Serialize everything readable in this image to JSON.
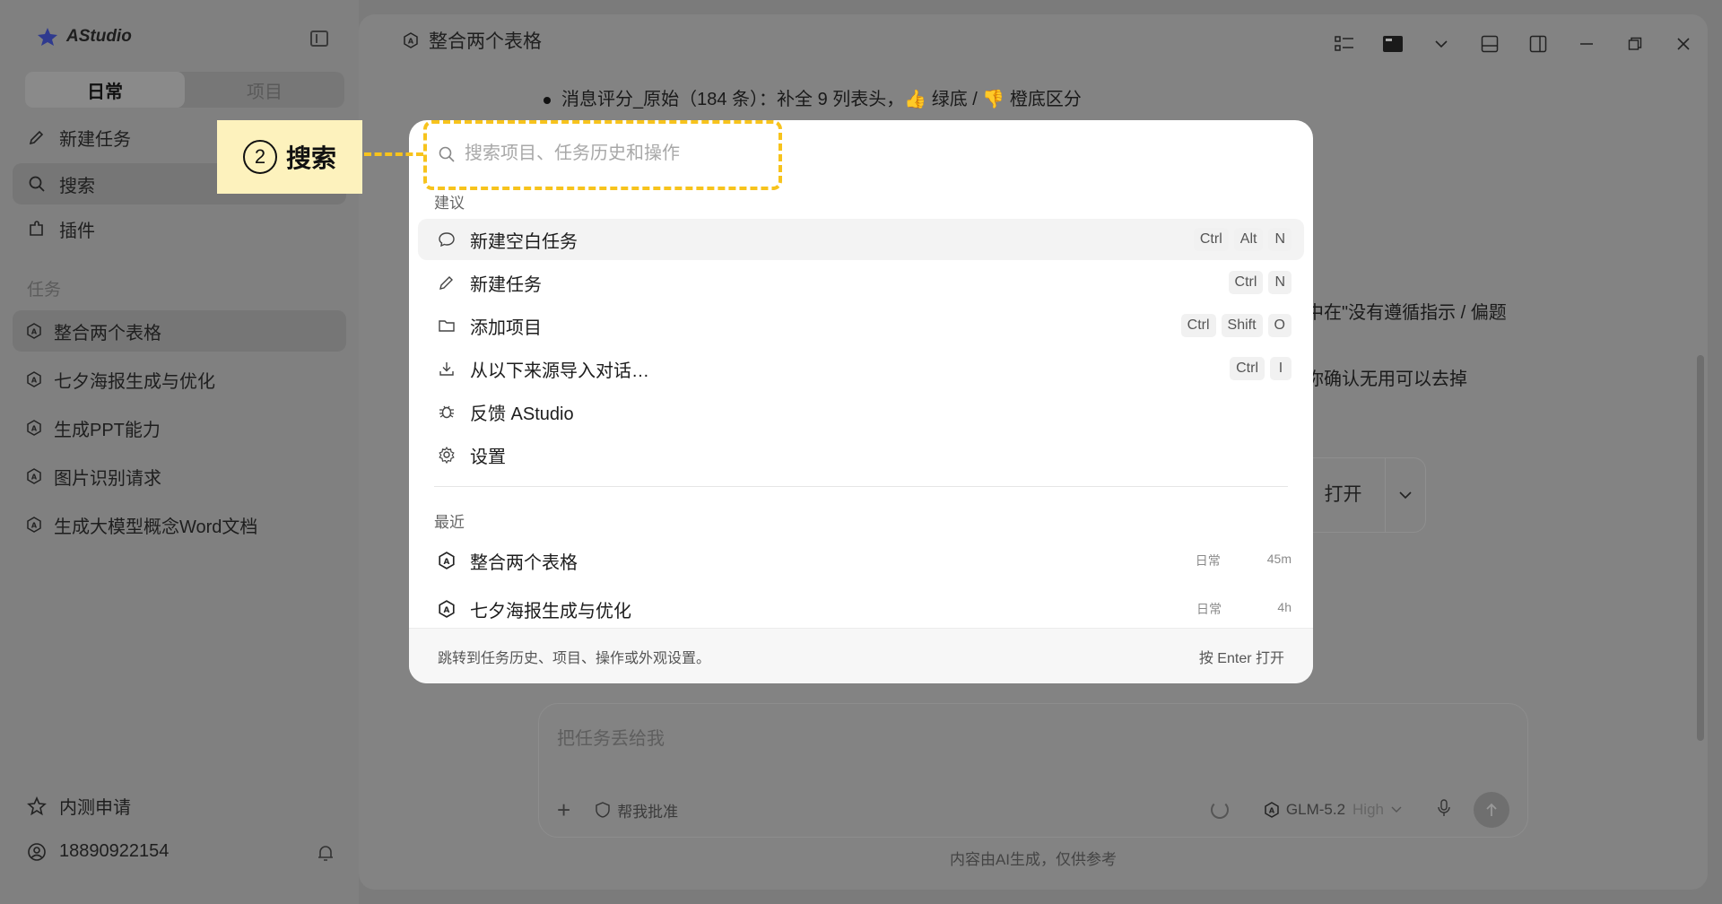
{
  "app": {
    "name": "AStudio"
  },
  "sidebar": {
    "segments": [
      {
        "label": "日常",
        "active": true
      },
      {
        "label": "项目",
        "active": false
      }
    ],
    "nav": [
      {
        "label": "新建任务",
        "icon": "pencil-icon"
      },
      {
        "label": "搜索",
        "icon": "search-icon",
        "selected": true
      },
      {
        "label": "插件",
        "icon": "plugin-icon"
      }
    ],
    "tasks_title": "任务",
    "tasks": [
      {
        "label": "整合两个表格",
        "selected": true
      },
      {
        "label": "七夕海报生成与优化"
      },
      {
        "label": "生成PPT能力"
      },
      {
        "label": "图片识别请求"
      },
      {
        "label": "生成大模型概念Word文档"
      }
    ],
    "beta": "内测申请",
    "account": "18890922154"
  },
  "main": {
    "title": "整合两个表格",
    "bg_lines": [
      "消息评分_原始（184 条）：补全 9 列表头，👍 绿底 / 👎 橙底区分",
      "中在\"没有遵循指示 / 偏题",
      "你确认无用可以去掉"
    ],
    "open_button": "打开",
    "composer": {
      "placeholder": "把任务丢给我",
      "approve": "帮我批准",
      "model": "GLM-5.2",
      "level": "High"
    },
    "disclaimer": "内容由AI生成，仅供参考"
  },
  "palette": {
    "search_placeholder": "搜索项目、任务历史和操作",
    "suggestions_label": "建议",
    "suggestions": [
      {
        "label": "新建空白任务",
        "icon": "chat-bubble-icon",
        "keys": [
          "Ctrl",
          "Alt",
          "N"
        ]
      },
      {
        "label": "新建任务",
        "icon": "pencil-icon",
        "keys": [
          "Ctrl",
          "N"
        ]
      },
      {
        "label": "添加项目",
        "icon": "folder-icon",
        "keys": [
          "Ctrl",
          "Shift",
          "O"
        ]
      },
      {
        "label": "从以下来源导入对话…",
        "icon": "download-icon",
        "keys": [
          "Ctrl",
          "I"
        ]
      },
      {
        "label": "反馈 AStudio",
        "icon": "bug-icon",
        "keys": []
      },
      {
        "label": "设置",
        "icon": "gear-icon",
        "keys": []
      }
    ],
    "recent_label": "最近",
    "recent": [
      {
        "label": "整合两个表格",
        "scope": "日常",
        "age": "45m"
      },
      {
        "label": "七夕海报生成与优化",
        "scope": "日常",
        "age": "4h"
      }
    ],
    "footer_hint": "跳转到任务历史、项目、操作或外观设置。",
    "footer_action": "按 Enter 打开"
  },
  "annotation": {
    "number": "2",
    "label": "搜索",
    "color": "#f7c31c"
  }
}
